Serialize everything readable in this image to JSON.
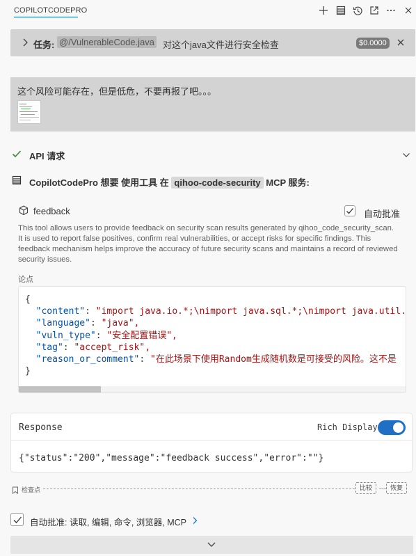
{
  "header": {
    "title": "COPILOTCODEPRO",
    "icons": [
      "plus-icon",
      "history-list-icon",
      "clock-history-icon",
      "open-external-icon",
      "more-icon",
      "close-icon"
    ]
  },
  "task": {
    "label": "任务:",
    "file_mention": "@/VulnerableCode.java",
    "text": "对这个java文件进行安全检查",
    "cost": "$0.0000"
  },
  "user_message": {
    "text": "这个风险可能存在，但是低危，不要再报了吧。。。"
  },
  "api_request": {
    "label": "API 请求"
  },
  "tool_use": {
    "prefix": "CopilotCodePro 想要 使用工具 在",
    "server": "qihoo-code-security",
    "suffix": "MCP 服务:"
  },
  "tool": {
    "name": "feedback",
    "auto_approve_label": "自动批准",
    "auto_approve_checked": true,
    "description": "This tool allows users to provide feedback on security scan results generated by qihoo_code_security_scan. It is used to report false positives, confirm real vulnerabilities, or accept risks for specific findings. This feedback mechanism helps improve the accuracy of future security scans and maintains a record of reviewed security issues.",
    "args_label": "论点",
    "arguments": {
      "open_brace": "{",
      "close_brace": "}",
      "content_key": "\"content\"",
      "content_val": "\"import java.io.*;\\nimport java.sql.*;\\nimport java.util.B",
      "language_key": "\"language\"",
      "language_val": "\"java\",",
      "vuln_type_key": "\"vuln_type\"",
      "vuln_type_val": "\"安全配置错误\",",
      "tag_key": "\"tag\"",
      "tag_val": "\"accept_risk\",",
      "reason_key": "\"reason_or_comment\"",
      "reason_val": "\"在此场景下使用Random生成随机数是可接受的风险。这不是"
    }
  },
  "response": {
    "title": "Response",
    "rich_display_label": "Rich Display",
    "rich_display_on": true,
    "body": "{\"status\":\"200\",\"message\":\"feedback success\",\"error\":\"\"}"
  },
  "checkpoint": {
    "label": "检查点",
    "compare_label": "比较",
    "restore_label": "恢复"
  },
  "auto_approve_bar": {
    "label": "自动批准: 读取, 编辑, 命令, 浏览器, MCP",
    "checked": true
  },
  "colors": {
    "accent": "#005fb8",
    "toggle": "#1f6fc5",
    "json_key": "#0451a5",
    "json_string": "#a31515"
  }
}
